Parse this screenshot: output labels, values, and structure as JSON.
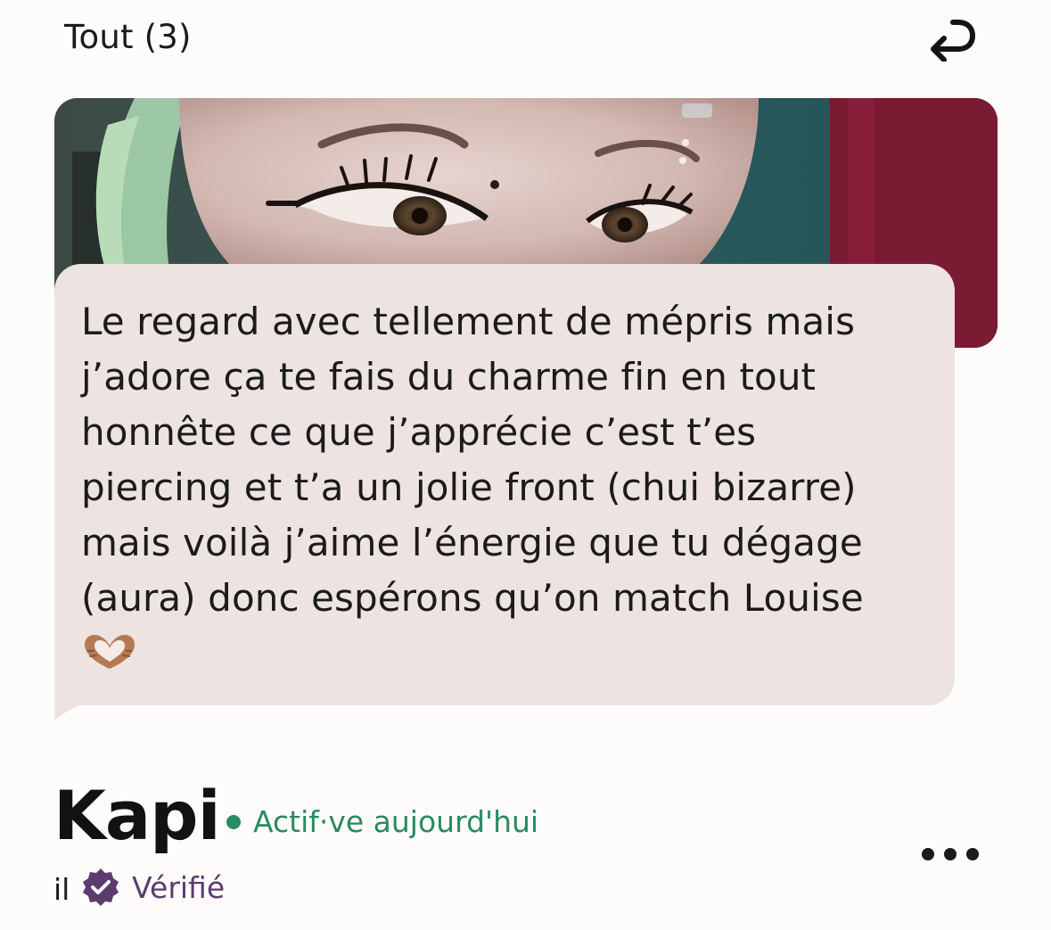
{
  "header": {
    "title": "Tout (3)",
    "undo_icon": "undo-return-arrow-icon"
  },
  "photo": {
    "description_icon": "profile-photo"
  },
  "message": {
    "lines": [
      "Le regard avec tellement de mépris mais",
      "j’adore ça te fais du charme fin en tout",
      "honnête ce que j’apprécie c’est t’es",
      "piercing et t’a un jolie front (chui bizarre)",
      "mais voilà j’aime l’énergie que tu dégage",
      "(aura) donc espérons qu’on match Louise"
    ],
    "emoji": "heart-hands-emoji"
  },
  "profile": {
    "name": "Kapi",
    "status": "Actif·ve aujourd'hui",
    "status_color": "#2a8a60",
    "pronoun": "il",
    "verified_label": "Vérifié",
    "verified_color": "#5c3b6f",
    "more_icon": "more-dots-icon"
  }
}
